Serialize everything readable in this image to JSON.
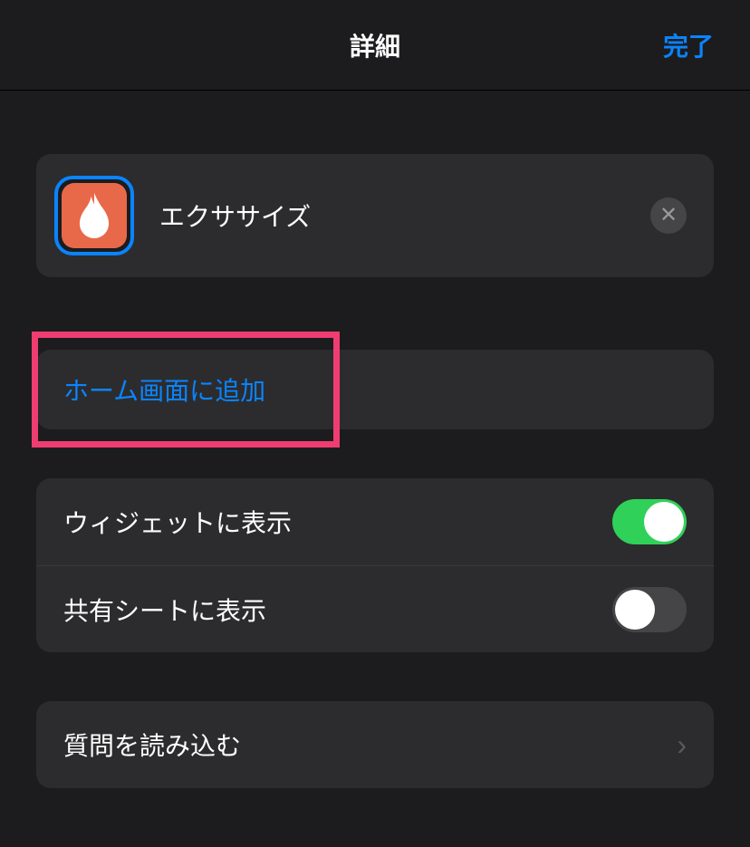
{
  "header": {
    "title": "詳細",
    "done": "完了"
  },
  "shortcut": {
    "name": "エクササイズ"
  },
  "addToHome": {
    "label": "ホーム画面に追加"
  },
  "settings": {
    "widget": "ウィジェットに表示",
    "shareSheet": "共有シートに表示"
  },
  "questions": {
    "label": "質問を読み込む"
  }
}
